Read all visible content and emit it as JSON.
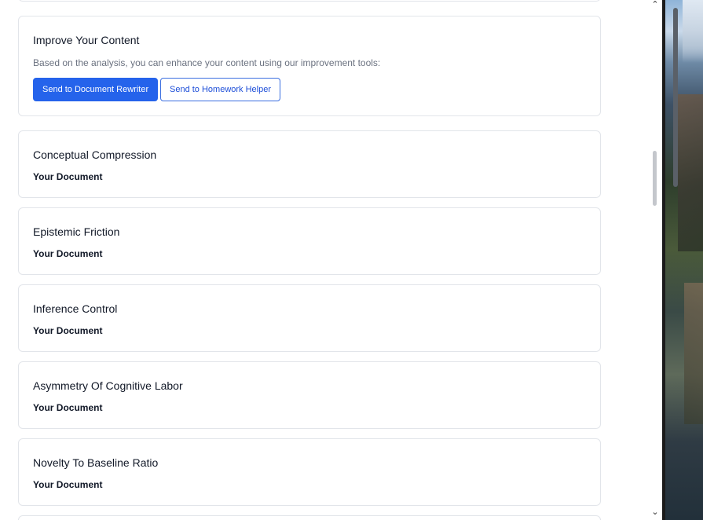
{
  "improve": {
    "title": "Improve Your Content",
    "description": "Based on the analysis, you can enhance your content using our improvement tools:",
    "rewriter_button": "Send to Document Rewriter",
    "homework_button": "Send to Homework Helper"
  },
  "metrics": [
    {
      "title": "Conceptual Compression",
      "subtitle": "Your Document"
    },
    {
      "title": "Epistemic Friction",
      "subtitle": "Your Document"
    },
    {
      "title": "Inference Control",
      "subtitle": "Your Document"
    },
    {
      "title": "Asymmetry Of Cognitive Labor",
      "subtitle": "Your Document"
    },
    {
      "title": "Novelty To Baseline Ratio",
      "subtitle": "Your Document"
    }
  ],
  "scroll_icons": {
    "up": "chevron-up-icon",
    "down": "chevron-down-icon"
  }
}
